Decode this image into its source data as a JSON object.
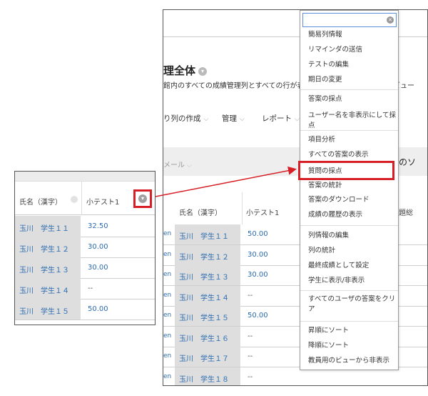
{
  "main": {
    "title": "理全体",
    "description": "館内のすべての成績管理列とすべての行が表示",
    "description_right": "ビュー",
    "actions": [
      {
        "label": "り列の作成"
      },
      {
        "label": "管理"
      },
      {
        "label": "レポート"
      }
    ],
    "filter_mail": "メール",
    "filter_right": "のソ",
    "grid": {
      "header_left_fragment": "",
      "column_name": "氏名（漢字）",
      "column_score": "小テスト1",
      "header_right_end": "題総",
      "rows": [
        {
          "id_fragment": "en",
          "name": "玉川　学生１１",
          "score": "50.00"
        },
        {
          "id_fragment": "en",
          "name": "玉川　学生１２",
          "score": "30.00"
        },
        {
          "id_fragment": "en",
          "name": "玉川　学生１３",
          "score": "30.00"
        },
        {
          "id_fragment": "en",
          "name": "玉川　学生１４",
          "score": "--"
        },
        {
          "id_fragment": "en",
          "name": "玉川　学生１５",
          "score": "50.00"
        },
        {
          "id_fragment": "en",
          "name": "玉川　学生１６",
          "score": "--"
        },
        {
          "id_fragment": "en",
          "name": "玉川　学生１７",
          "score": "--"
        },
        {
          "id_fragment": "en",
          "name": "玉川　学生１８",
          "score": "--"
        }
      ]
    }
  },
  "zoom": {
    "column_name": "氏名（漢字）",
    "column_score": "小テスト1",
    "rows": [
      {
        "name": "玉川　学生１１",
        "score": "32.50"
      },
      {
        "name": "玉川　学生１２",
        "score": "30.00"
      },
      {
        "name": "玉川　学生１３",
        "score": "30.00"
      },
      {
        "name": "玉川　学生１４",
        "score": "--"
      },
      {
        "name": "玉川　学生１５",
        "score": "50.00"
      }
    ]
  },
  "dropdown": {
    "search_value": "",
    "items": [
      "簡易列情報",
      "リマインダの送信",
      "テストの編集",
      "期日の変更",
      "答案の採点",
      "ユーザー名を非表示にして採点",
      "項目分析",
      "すべての答案の表示",
      "質問の採点",
      "答案の統計",
      "答案のダウンロード",
      "成績の履歴の表示",
      "列情報の編集",
      "列の統計",
      "最終成績として設定",
      "学生に表示/非表示",
      "すべてのユーザの答案をクリア",
      "昇順にソート",
      "降順にソート",
      "教員用のビューから非表示"
    ],
    "highlighted_item": "質問の採点"
  },
  "colors": {
    "highlight_red": "#d61f26",
    "link_blue": "#2a6bb0",
    "name_cell_gray": "#dedede"
  }
}
